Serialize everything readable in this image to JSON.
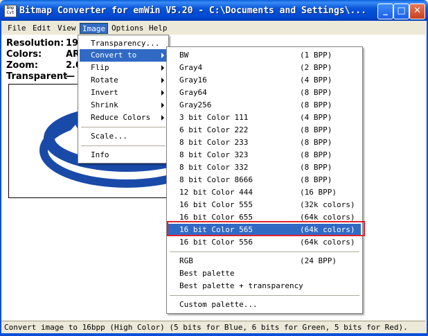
{
  "window": {
    "title": "Bitmap Converter for emWin V5.20 - C:\\Documents and Settings\\...",
    "icon_label": "Bmp Cvt",
    "min_glyph": "_",
    "max_glyph": "□",
    "close_glyph": "✕"
  },
  "menubar": [
    "File",
    "Edit",
    "View",
    "Image",
    "Options",
    "Help"
  ],
  "info": {
    "resolution_label": "Resolution:",
    "resolution_value": "19",
    "colors_label": "Colors:",
    "colors_value": "AR",
    "zoom_label": "Zoom:",
    "zoom_value": "2.0",
    "transparent_label": "Transparent",
    "transparent_value": "—"
  },
  "image_menu": [
    "Transparency...",
    "Convert to",
    "Flip",
    "Rotate",
    "Invert",
    "Shrink",
    "Reduce Colors",
    "Scale...",
    "Info"
  ],
  "convert_menu": [
    {
      "name": "BW",
      "bpp": "(1 BPP)"
    },
    {
      "name": "Gray4",
      "bpp": "(2 BPP)"
    },
    {
      "name": "Gray16",
      "bpp": "(4 BPP)"
    },
    {
      "name": "Gray64",
      "bpp": "(8 BPP)"
    },
    {
      "name": "Gray256",
      "bpp": "(8 BPP)"
    },
    {
      "name": "3 bit Color 111",
      "bpp": "(4 BPP)"
    },
    {
      "name": "6 bit Color 222",
      "bpp": "(8 BPP)"
    },
    {
      "name": "8 bit Color 233",
      "bpp": "(8 BPP)"
    },
    {
      "name": "8 bit Color 323",
      "bpp": "(8 BPP)"
    },
    {
      "name": "8 bit Color 332",
      "bpp": "(8 BPP)"
    },
    {
      "name": "8 bit Color 8666",
      "bpp": "(8 BPP)"
    },
    {
      "name": "12 bit Color 444",
      "bpp": "(16 BPP)"
    },
    {
      "name": "16 bit Color 555",
      "bpp": "(32k colors)"
    },
    {
      "name": "16 bit Color 655",
      "bpp": "(64k colors)"
    },
    {
      "name": "16 bit Color 565",
      "bpp": "(64k colors)"
    },
    {
      "name": "16 bit Color 556",
      "bpp": "(64k colors)"
    },
    {
      "name": "RGB",
      "bpp": "(24 BPP)"
    },
    {
      "name": "Best palette",
      "bpp": ""
    },
    {
      "name": "Best palette + transparency",
      "bpp": ""
    },
    {
      "name": "Custom palette...",
      "bpp": ""
    }
  ],
  "status": "Convert image to 16bpp (High Color) (5 bits for Blue, 6 bits for Green, 5 bits for Red).",
  "colors": {
    "highlight": "#316ac5",
    "emphasis_box": "#e0202a",
    "logo_blue": "#1a4aa8"
  }
}
